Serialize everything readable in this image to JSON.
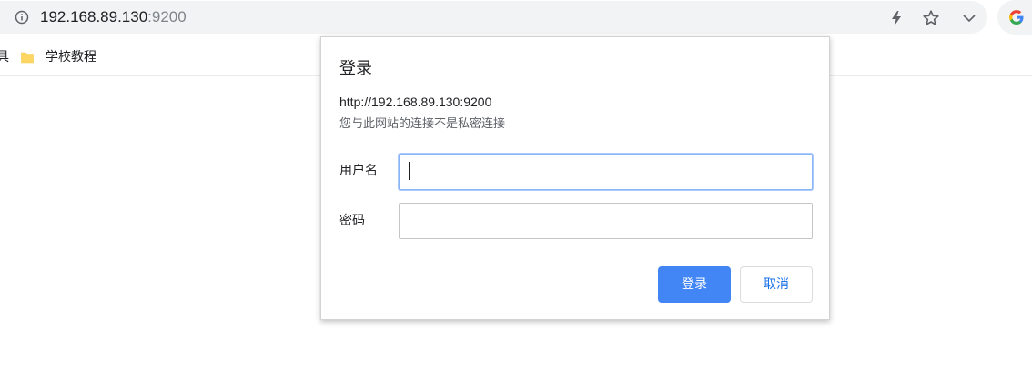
{
  "browser": {
    "address_bar": {
      "url_host": "192.168.89.130",
      "url_port": ":9200",
      "info_icon": "info-icon",
      "actions": [
        "lightning-icon",
        "star-icon",
        "chevron-down-icon"
      ]
    },
    "profile_icon": "google-g-icon"
  },
  "bookmarks": {
    "cut_label": "具",
    "items": [
      {
        "label": "学校教程",
        "icon": "folder-icon"
      }
    ]
  },
  "dialog": {
    "title": "登录",
    "url": "http://192.168.89.130:9200",
    "warning": "您与此网站的连接不是私密连接",
    "username_label": "用户名",
    "username_value": "",
    "password_label": "密码",
    "password_value": "",
    "login_button": "登录",
    "cancel_button": "取消"
  },
  "colors": {
    "primary": "#4285f4",
    "link_blue": "#1a73e8",
    "focus_border": "#8ab4f8",
    "omnibox_bg": "#f1f3f4"
  }
}
